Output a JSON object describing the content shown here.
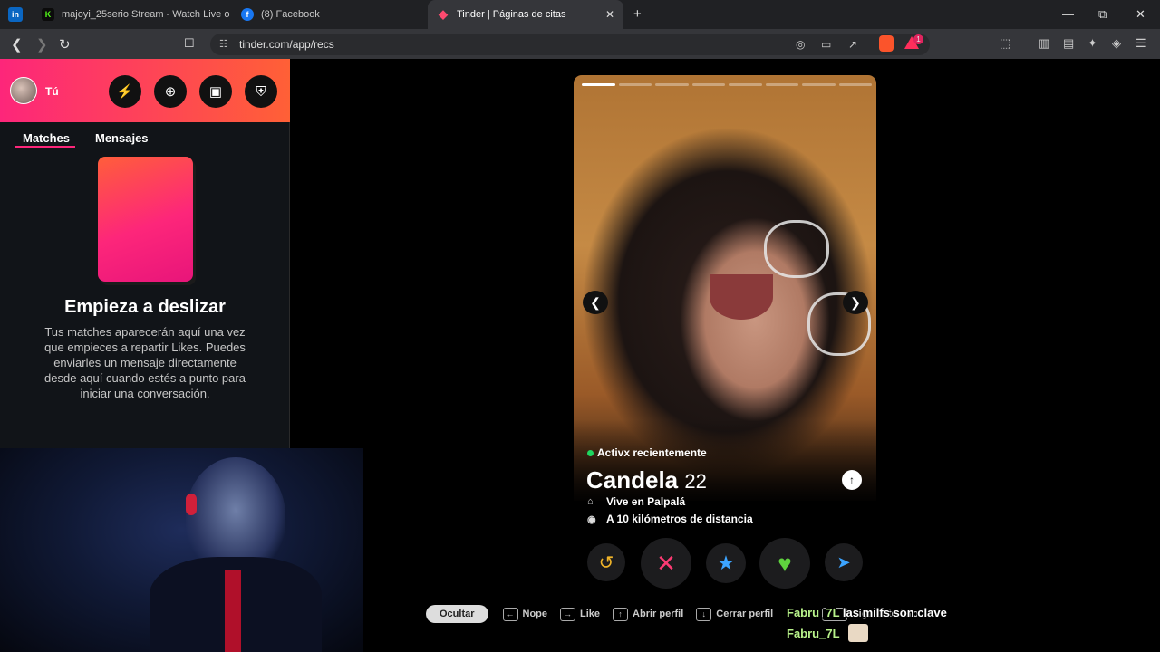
{
  "browser": {
    "tabs": [
      {
        "title": "majoyi_25serio Stream - Watch Live o",
        "icon": "kick-icon",
        "color": "#53fc18"
      },
      {
        "title": "(8) Facebook",
        "icon": "facebook-icon",
        "color": "#1877f2"
      },
      {
        "title": "Tinder | Páginas de citas",
        "icon": "tinder-icon",
        "color": "#fd267a",
        "active": true
      }
    ],
    "pinned_icon": "linkedin-icon",
    "new_tab": "+",
    "url": "tinder.com/app/recs",
    "brave_badge": "1"
  },
  "sidebar": {
    "profile_label": "Tú",
    "buttons": [
      "boost-icon",
      "explore-icon",
      "briefcase-icon",
      "shield-icon"
    ],
    "tabs": [
      {
        "label": "Matches",
        "active": true
      },
      {
        "label": "Mensajes",
        "active": false
      }
    ],
    "empty_title": "Empieza a deslizar",
    "empty_text": "Tus matches aparecerán aquí una vez que empieces a repartir Likes. Puedes enviarles un mensaje directamente desde aquí cuando estés a punto para iniciar una conversación."
  },
  "card": {
    "photo_count": 8,
    "photo_index": 1,
    "status": "Activx recientemente",
    "name": "Candela",
    "age": "22",
    "lives": "Vive en Palpalá",
    "distance": "A 10 kilómetros de distancia",
    "accent": "#fd267a",
    "actions": [
      "rewind-icon",
      "nope-icon",
      "super-like-icon",
      "like-icon",
      "boost-send-icon"
    ]
  },
  "shortcuts": {
    "hide_label": "Ocultar",
    "items": [
      "Nope",
      "Like",
      "Abrir perfil",
      "Cerrar perfil",
      "Siguiente foto"
    ]
  },
  "chat": [
    {
      "user": "Fabru_7L",
      "message": "las milfs son clave"
    },
    {
      "user": "Fabru_7L",
      "message": ""
    }
  ]
}
